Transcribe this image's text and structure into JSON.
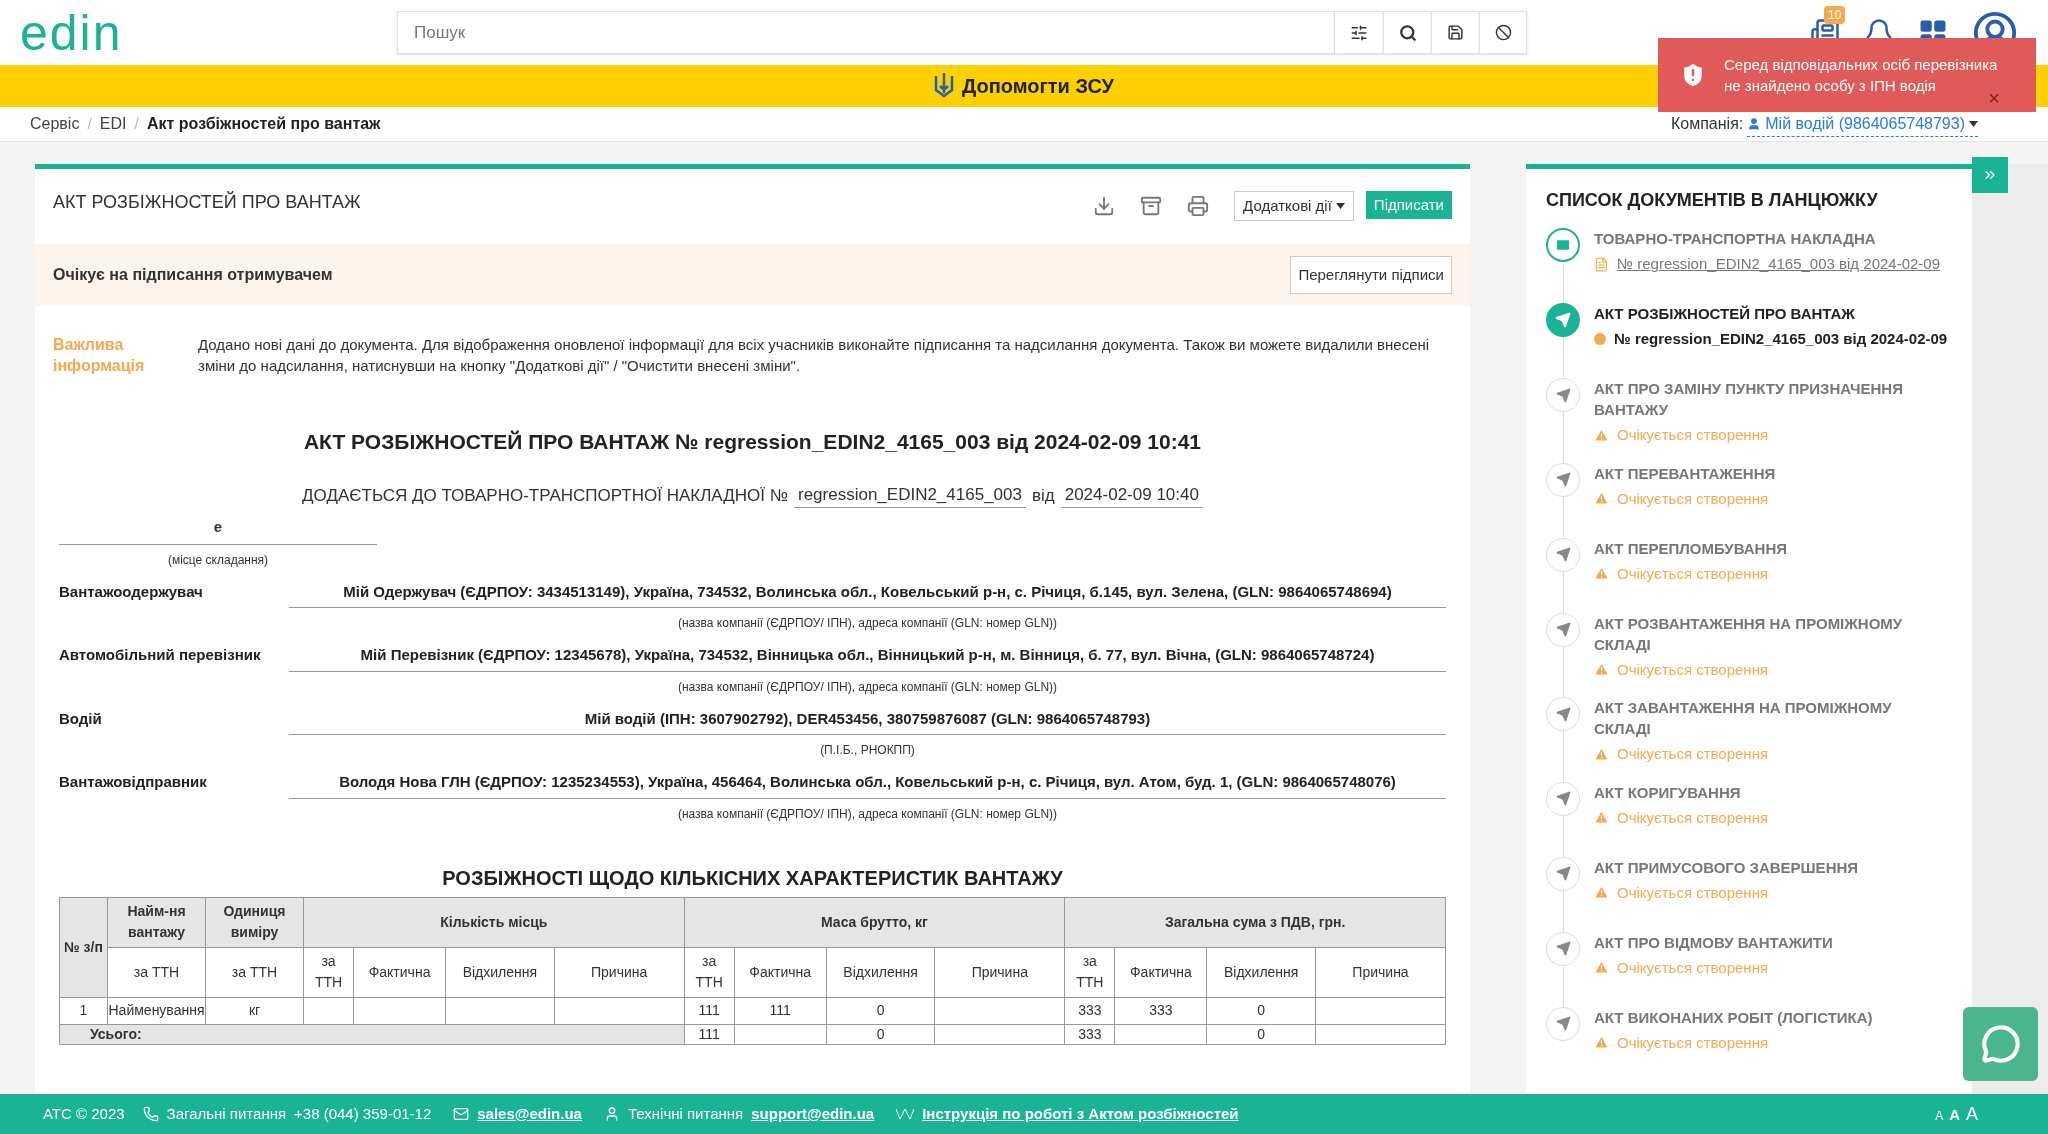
{
  "header": {
    "logo": "edin",
    "search": {
      "placeholder": "Пошук"
    },
    "notification_count": "10"
  },
  "toast": {
    "message": "Серед відповідальних осіб перевізника не знайдено особу з ІПН водія",
    "close": "×"
  },
  "banner": "Допомогти ЗСУ",
  "breadcrumb_separator": "/",
  "breadcrumbs": [
    {
      "label": "Сервіс",
      "selected": false
    },
    {
      "label": "EDI",
      "selected": false
    },
    {
      "label": "Акт розбіжностей про вантаж",
      "selected": true
    }
  ],
  "company": {
    "label": "Компанія:",
    "value": "Мій водій (9864065748793)"
  },
  "document": {
    "title": "АКТ РОЗБІЖНОСТЕЙ ПРО ВАНТАЖ",
    "actions_dropdown": "Додаткові дії",
    "sign_button": "Підписати",
    "status": "Очікує на підписання отримувачем",
    "view_signatures": "Переглянути підписи",
    "notice": {
      "label": "Важлива інформація",
      "text": "Додано нові дані до документа. Для відображення оновленої інформації для всіх учасників виконайте підписання та надсилання документа. Також ви можете видалили внесені зміни до надсилання, натиснувши на кнопку \"Додаткові дії\" / \"Очистити внесені зміни\"."
    },
    "heading": "АКТ РОЗБІЖНОСТЕЙ ПРО ВАНТАЖ № regression_EDIN2_4165_003 від 2024-02-09 10:41",
    "attached": {
      "prefix": "ДОДАЄТЬСЯ ДО ТОВАРНО-ТРАНСПОРТНОЇ НАКЛАДНОЇ №",
      "number": "regression_EDIN2_4165_003",
      "from": "від",
      "date": "2024-02-09 10:40"
    },
    "place": {
      "value": "е",
      "caption": "(місце складання)"
    },
    "parties": [
      {
        "label": "Вантажоодержувач",
        "value": "Мій Одержувач (ЄДРПОУ: 3434513149), Україна, 734532, Волинська обл., Ковельський р-н, с. Річиця, б.145, вул. Зелена, (GLN: 9864065748694)",
        "caption": "(назва компанії (ЄДРПОУ/ ІПН), адреса компанії (GLN: номер GLN))"
      },
      {
        "label": "Автомобільний перевізник",
        "value": "Мій Перевізник (ЄДРПОУ: 12345678), Україна, 734532, Вінницька обл., Вінницький р-н, м. Вінниця, б. 77, вул. Вічна, (GLN: 9864065748724)",
        "caption": "(назва компанії (ЄДРПОУ/ ІПН), адреса компанії (GLN: номер GLN))"
      },
      {
        "label": "Водій",
        "value": "Мій водій (ІПН: 3607902792), DER453456, 380759876087 (GLN: 9864065748793)",
        "caption": "(П.І.Б., РНОКПП)"
      },
      {
        "label": "Вантажовідправник",
        "value": "Володя Нова ГЛН (ЄДРПОУ: 1235234553), Україна, 456464, Волинська обл., Ковельський р-н, с. Річиця, вул. Атом, буд. 1, (GLN: 9864065748076)",
        "caption": "(назва компанії (ЄДРПОУ/ ІПН), адреса компанії (GLN: номер GLN))"
      }
    ],
    "table": {
      "title": "РОЗБІЖНОСТІ ЩОДО КІЛЬКІСНИХ ХАРАКТЕРИСТИК ВАНТАЖУ",
      "fixed_columns": [
        {
          "label": "№ з/п"
        },
        {
          "label": "Найм-ня вантажу",
          "sub": "за ТТН"
        },
        {
          "label": "Одиниця виміру",
          "sub": "за ТТН"
        }
      ],
      "groups": [
        {
          "label": "Кількість місць",
          "columns": [
            "за ТТН",
            "Фактична",
            "Відхилення",
            "Причина"
          ]
        },
        {
          "label": "Маса брутто, кг",
          "columns": [
            "за ТТН",
            "Фактична",
            "Відхилення",
            "Причина"
          ]
        },
        {
          "label": "Загальна сума з ПДВ, грн.",
          "columns": [
            "за ТТН",
            "Фактична",
            "Відхилення",
            "Причина"
          ]
        }
      ],
      "rows": [
        {
          "cells": [
            "1",
            "Найменування",
            "кг",
            null,
            null,
            null,
            null,
            "111",
            "111",
            "0",
            null,
            "333",
            "333",
            "0",
            null
          ]
        }
      ],
      "total": {
        "label": "Усього:",
        "cells": [
          "111",
          null,
          "0",
          null,
          "333",
          null,
          "0",
          null
        ]
      }
    }
  },
  "chain": {
    "title": "СПИСОК ДОКУМЕНТІВ В ЛАНЦЮЖКУ",
    "items": [
      {
        "kind": "received",
        "title": "ТОВАРНО-ТРАНСПОРТНА НАКЛАДНА",
        "detail": "№ regression_EDIN2_4165_003 від 2024-02-09"
      },
      {
        "kind": "current",
        "title": "АКТ РОЗБІЖНОСТЕЙ ПРО ВАНТАЖ",
        "detail": "№ regression_EDIN2_4165_003 від 2024-02-09"
      },
      {
        "kind": "pending",
        "title": "АКТ ПРО ЗАМІНУ ПУНКТУ ПРИЗНАЧЕННЯ ВАНТАЖУ",
        "detail": "Очікується створення"
      },
      {
        "kind": "pending",
        "title": "АКТ ПЕРЕВАНТАЖЕННЯ",
        "detail": "Очікується створення"
      },
      {
        "kind": "pending",
        "title": "АКТ ПЕРЕПЛОМБУВАННЯ",
        "detail": "Очікується створення"
      },
      {
        "kind": "pending",
        "title": "АКТ РОЗВАНТАЖЕННЯ НА ПРОМІЖНОМУ СКЛАДІ",
        "detail": "Очікується створення"
      },
      {
        "kind": "pending",
        "title": "АКТ ЗАВАНТАЖЕННЯ НА ПРОМІЖНОМУ СКЛАДІ",
        "detail": "Очікується створення"
      },
      {
        "kind": "pending",
        "title": "АКТ КОРИГУВАННЯ",
        "detail": "Очікується створення"
      },
      {
        "kind": "pending",
        "title": "АКТ ПРИМУСОВОГО ЗАВЕРШЕННЯ",
        "detail": "Очікується створення"
      },
      {
        "kind": "pending",
        "title": "АКТ ПРО ВІДМОВУ ВАНТАЖИТИ",
        "detail": "Очікується створення"
      },
      {
        "kind": "pending",
        "title": "АКТ ВИКОНАНИХ РОБІТ (ЛОГІСТИКА)",
        "detail": "Очікується створення"
      }
    ]
  },
  "footer": {
    "copyright": "АТС © 2023",
    "general_label": "Загальні питання",
    "phone": "+38 (044) 359-01-12",
    "sales_email": "sales@edin.ua",
    "tech_label": "Технічні питання",
    "support_email": "support@edin.ua",
    "manual_link": "Інструкція по роботі з Актом розбіжностей",
    "font_sizes": [
      "A",
      "A",
      "A"
    ]
  }
}
